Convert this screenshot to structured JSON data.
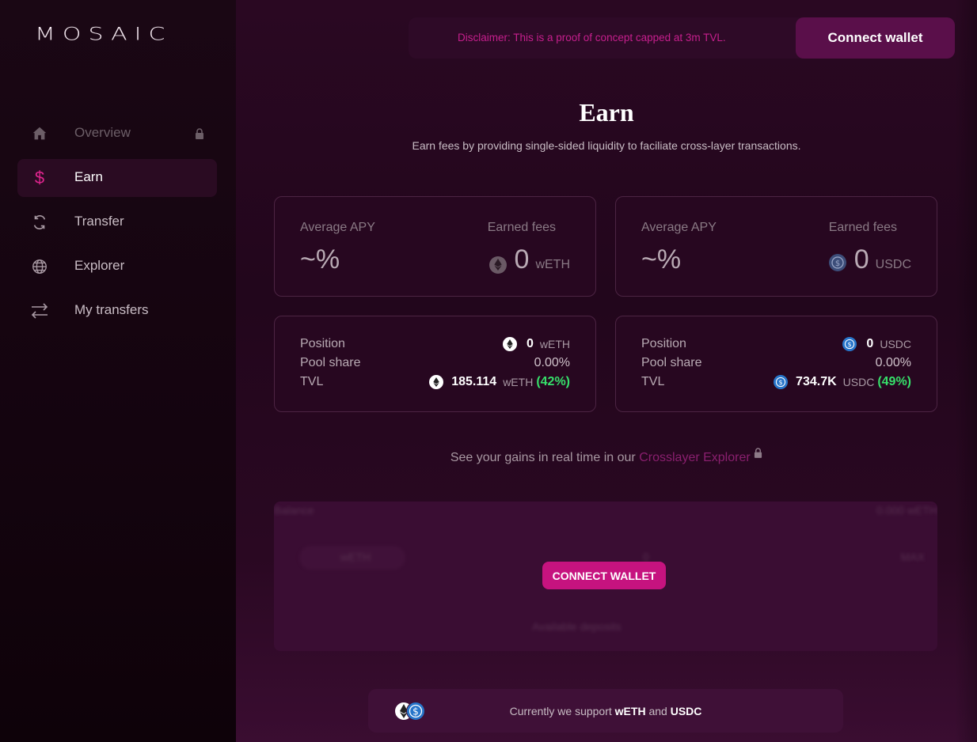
{
  "app": {
    "logo": "MOSAIC"
  },
  "sidebar": {
    "items": [
      {
        "label": "Overview",
        "icon": "home-icon",
        "state": "disabled",
        "locked": true
      },
      {
        "label": "Earn",
        "icon": "dollar-icon",
        "state": "active"
      },
      {
        "label": "Transfer",
        "icon": "refresh-icon",
        "state": "normal"
      },
      {
        "label": "Explorer",
        "icon": "globe-icon",
        "state": "normal"
      },
      {
        "label": "My transfers",
        "icon": "arrows-swap-icon",
        "state": "normal"
      }
    ]
  },
  "header": {
    "disclaimer": "Disclaimer: This is a proof of concept capped at 3m TVL.",
    "connect_label": "Connect wallet"
  },
  "page": {
    "title": "Earn",
    "subtitle": "Earn fees by providing single-sided liquidity to faciliate cross-layer transactions."
  },
  "pools": [
    {
      "token": "wETH",
      "apy_label": "Average APY",
      "apy_value": "~%",
      "fees_label": "Earned fees",
      "fees_value": "0",
      "position_label": "Position",
      "position_value": "0",
      "pool_share_label": "Pool share",
      "pool_share_value": "0.00%",
      "tvl_label": "TVL",
      "tvl_value": "185.114",
      "tvl_pct": "(42%)"
    },
    {
      "token": "USDC",
      "apy_label": "Average APY",
      "apy_value": "~%",
      "fees_label": "Earned fees",
      "fees_value": "0",
      "position_label": "Position",
      "position_value": "0",
      "pool_share_label": "Pool share",
      "pool_share_value": "0.00%",
      "tvl_label": "TVL",
      "tvl_value": "734.7K",
      "tvl_pct": "(49%)"
    }
  ],
  "gains": {
    "prefix": "See your gains in real time in our",
    "link": "Crosslayer Explorer"
  },
  "deposit": {
    "balance_label": "Balance",
    "balance_value": "0.000 wETH",
    "token": "wETH",
    "amount": "0",
    "max_label": "MAX",
    "connect_label": "CONNECT WALLET",
    "footer_hint": "Available deposits"
  },
  "support": {
    "prefix": "Currently we support",
    "token_a": "wETH",
    "and": "and",
    "token_b": "USDC"
  },
  "colors": {
    "accent": "#c6137f",
    "disclaimer": "#c61f8d",
    "positive": "#36e06a",
    "usdc": "#2775ca"
  }
}
